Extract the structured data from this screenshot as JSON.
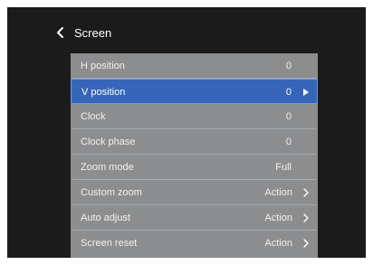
{
  "header": {
    "title": "Screen",
    "back_icon": "chevron-left-icon"
  },
  "menu": {
    "selected_index": 1,
    "items": [
      {
        "label": "H position",
        "value": "0",
        "arrow": ""
      },
      {
        "label": "V position",
        "value": "0",
        "arrow": "triangle-right-icon"
      },
      {
        "label": "Clock",
        "value": "0",
        "arrow": ""
      },
      {
        "label": "Clock phase",
        "value": "0",
        "arrow": ""
      },
      {
        "label": "Zoom mode",
        "value": "Full",
        "arrow": ""
      },
      {
        "label": "Custom zoom",
        "value": "Action",
        "arrow": "chevron-right-icon"
      },
      {
        "label": "Auto adjust",
        "value": "Action",
        "arrow": "chevron-right-icon"
      },
      {
        "label": "Screen reset",
        "value": "Action",
        "arrow": "chevron-right-icon"
      }
    ]
  },
  "colors": {
    "background": "#1b1b1b",
    "panel": "#8c8d8f",
    "selected": "#3765b9",
    "text": "#ffffff"
  }
}
